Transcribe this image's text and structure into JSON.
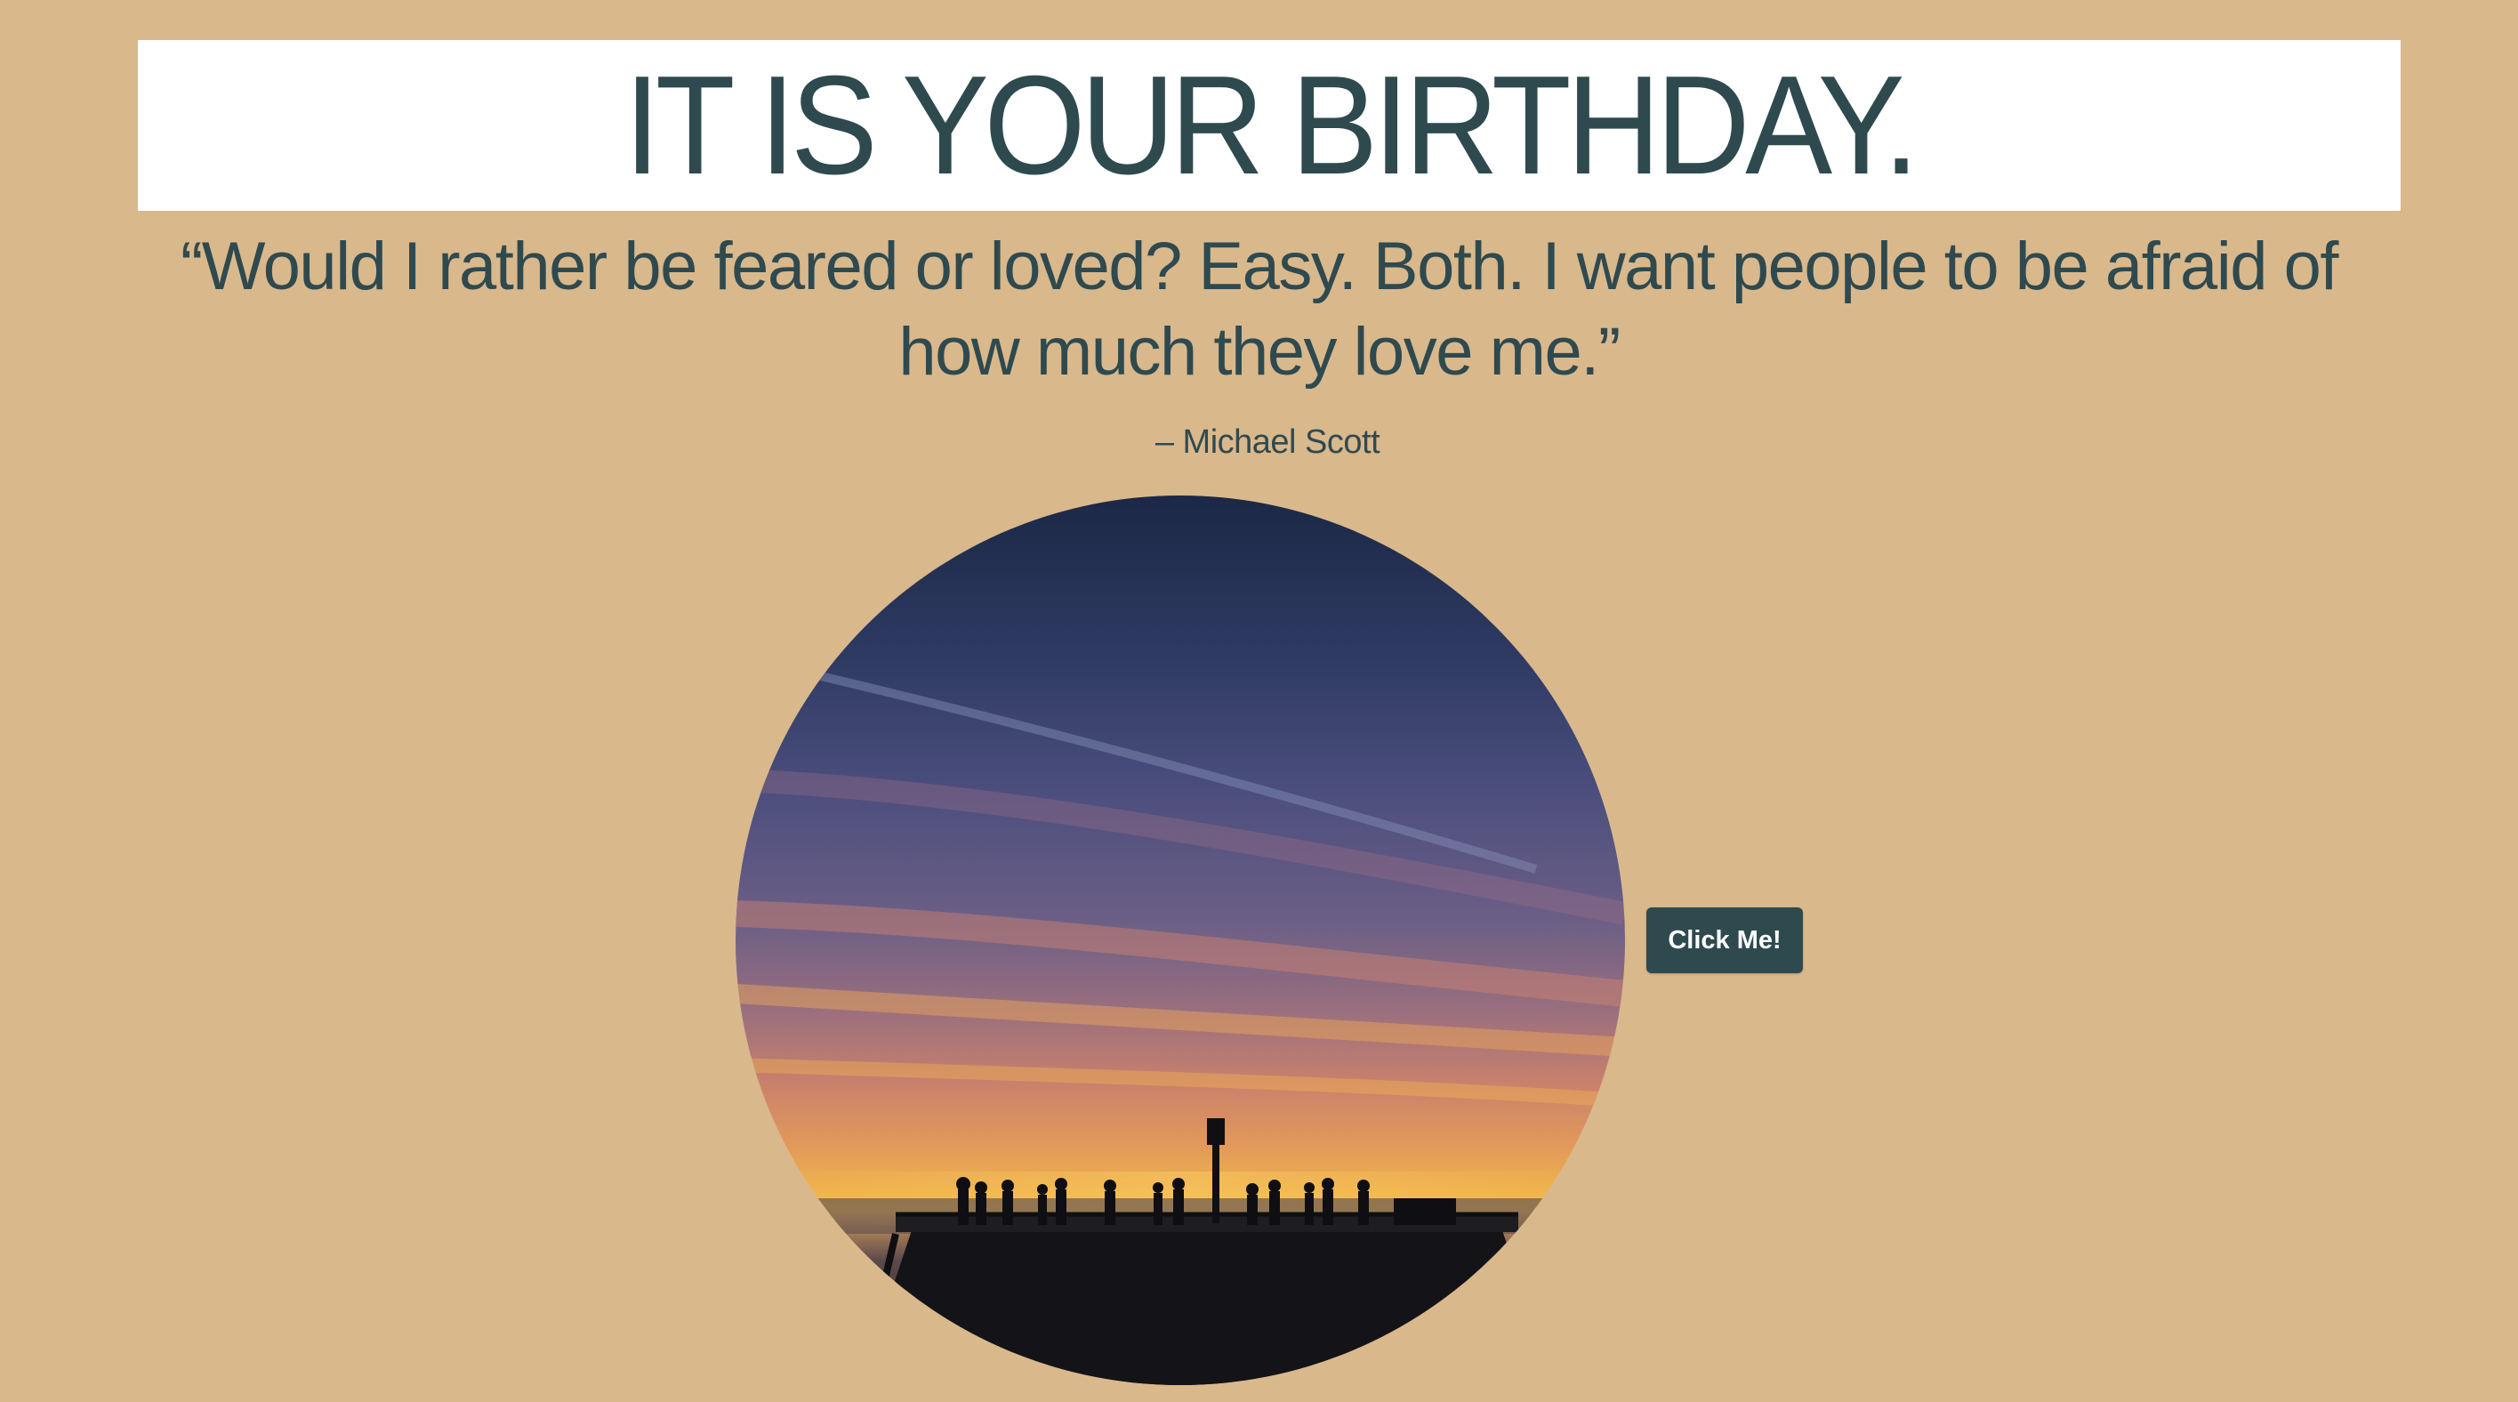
{
  "header": {
    "title": "IT IS YOUR BIRTHDAY."
  },
  "quote": {
    "text": "“Would I rather be feared or loved? Easy. Both. I want people to be afraid of how much they love me.”",
    "author": "– Michael Scott"
  },
  "photo": {
    "subject": "sunset-pier-photo"
  },
  "actions": {
    "click_label": "Click Me!"
  },
  "colors": {
    "background": "#d9b88c",
    "text": "#2f4a4f",
    "banner": "#ffffff",
    "button": "#2f4a4f"
  }
}
